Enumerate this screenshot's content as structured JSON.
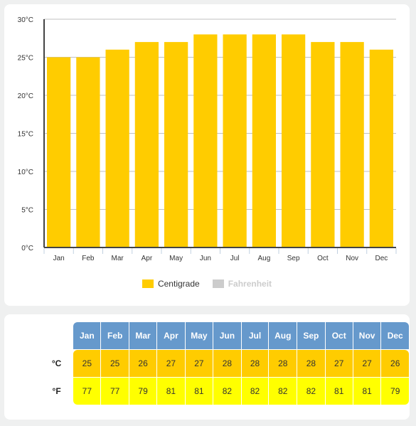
{
  "chart_data": {
    "type": "bar",
    "title": "",
    "xlabel": "",
    "ylabel": "",
    "categories": [
      "Jan",
      "Feb",
      "Mar",
      "Apr",
      "May",
      "Jun",
      "Jul",
      "Aug",
      "Sep",
      "Oct",
      "Nov",
      "Dec"
    ],
    "series": [
      {
        "name": "Centigrade",
        "color": "#ffcc00",
        "visible": true,
        "values": [
          25,
          25,
          26,
          27,
          27,
          28,
          28,
          28,
          28,
          27,
          27,
          26
        ]
      },
      {
        "name": "Fahrenheit",
        "color": "#cccccc",
        "visible": false,
        "values": [
          77,
          77,
          79,
          81,
          81,
          82,
          82,
          82,
          82,
          81,
          81,
          79
        ]
      }
    ],
    "ylim": [
      0,
      30
    ],
    "yticks": [
      0,
      5,
      10,
      15,
      20,
      25,
      30
    ],
    "ytick_suffix": "°C",
    "grid": true,
    "legend_position": "bottom-center"
  },
  "legend": [
    {
      "label": "Centigrade",
      "color": "#ffcc00",
      "active": true
    },
    {
      "label": "Fahrenheit",
      "color": "#cccccc",
      "active": false
    }
  ],
  "table": {
    "months": [
      "Jan",
      "Feb",
      "Mar",
      "Apr",
      "May",
      "Jun",
      "Jul",
      "Aug",
      "Sep",
      "Oct",
      "Nov",
      "Dec"
    ],
    "rows": [
      {
        "label": "°C",
        "values": [
          "25",
          "25",
          "26",
          "27",
          "27",
          "28",
          "28",
          "28",
          "28",
          "27",
          "27",
          "26"
        ]
      },
      {
        "label": "°F",
        "values": [
          "77",
          "77",
          "79",
          "81",
          "81",
          "82",
          "82",
          "82",
          "82",
          "81",
          "81",
          "79"
        ]
      }
    ]
  },
  "colors": {
    "header_bg": "#6699cc",
    "celsius_bg": "#ffcc00",
    "fahrenheit_bg": "#ffff00"
  }
}
